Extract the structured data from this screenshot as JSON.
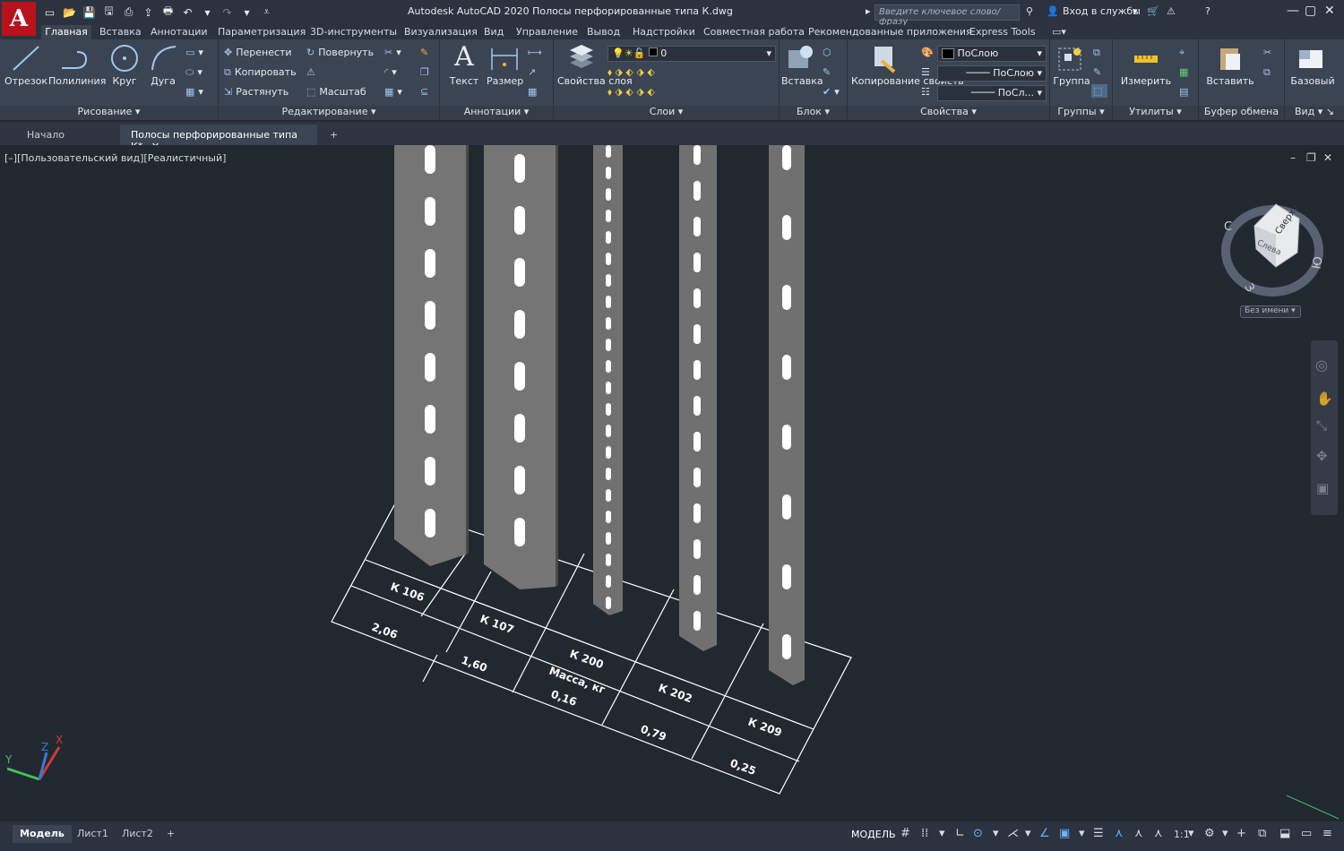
{
  "app": {
    "title": "Autodesk AutoCAD 2020    Полосы перфорированные типа К.dwg",
    "logo": "A",
    "search_placeholder": "Введите ключевое слово/фразу",
    "signin": "Вход в службы"
  },
  "menu_tabs": [
    "Главная",
    "Вставка",
    "Аннотации",
    "Параметризация",
    "3D-инструменты",
    "Визуализация",
    "Вид",
    "Управление",
    "Вывод",
    "Надстройки",
    "Совместная работа",
    "Рекомендованные приложения",
    "Express Tools"
  ],
  "ribbon": {
    "draw": {
      "title": "Рисование",
      "line": "Отрезок",
      "polyline": "Полилиния",
      "circle": "Круг",
      "arc": "Дуга"
    },
    "modify": {
      "title": "Редактирование",
      "move": "Перенести",
      "rotate": "Повернуть",
      "copy": "Копировать",
      "stretch": "Растянуть",
      "scale": "Масштаб"
    },
    "annotation": {
      "title": "Аннотации",
      "text": "Текст",
      "dimension": "Размер"
    },
    "layers": {
      "title": "Слои",
      "layer_props": "Свойства слоя",
      "current_layer": "0"
    },
    "block": {
      "title": "Блок",
      "insert": "Вставка"
    },
    "properties": {
      "title": "Свойства",
      "match": "Копирование свойств",
      "color": "ПоСлою",
      "linetype": "ПоСлою",
      "lineweight": "ПоСл..."
    },
    "groups": {
      "title": "Группы",
      "group": "Группа"
    },
    "utilities": {
      "title": "Утилиты",
      "measure": "Измерить"
    },
    "clipboard": {
      "title": "Буфер обмена",
      "paste": "Вставить"
    },
    "view": {
      "title": "Вид",
      "base": "Базовый"
    }
  },
  "doc_tabs": {
    "start": "Начало",
    "drawing": "Полосы перфорированные типа К*"
  },
  "viewport": {
    "label": "[–][Пользовательский вид][Реалистичный]",
    "viewcube": {
      "top": "Сверху",
      "left": "Слева",
      "compass_c": "С",
      "compass_z": "З",
      "compass_yu": "Ю",
      "ucs": "Без имени"
    },
    "table": {
      "codes": [
        "К 106",
        "К 107",
        "К 200",
        "К 202",
        "К 209"
      ],
      "mass_label": "Масса, кг",
      "masses": [
        "2,06",
        "1,60",
        "0,16",
        "0,79",
        "0,25"
      ]
    }
  },
  "status": {
    "layout_tabs": [
      "Модель",
      "Лист1",
      "Лист2"
    ],
    "mode": "МОДЕЛЬ",
    "scale": "1:1"
  }
}
